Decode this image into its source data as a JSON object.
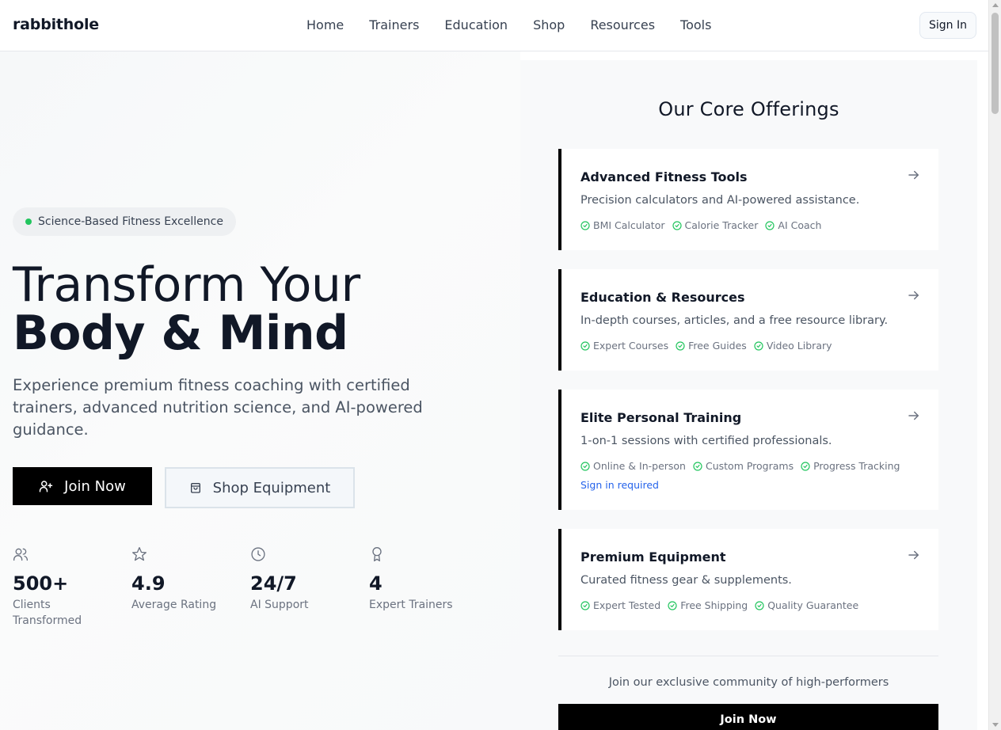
{
  "header": {
    "brand": "rabbithole",
    "nav": [
      "Home",
      "Trainers",
      "Education",
      "Shop",
      "Resources",
      "Tools"
    ],
    "sign_in": "Sign In"
  },
  "hero": {
    "badge": "Science-Based Fitness Excellence",
    "title_line1": "Transform Your",
    "title_line2": "Body & Mind",
    "lead": "Experience premium fitness coaching with certified trainers, advanced nutrition science, and AI-powered guidance.",
    "join_button": "Join Now",
    "shop_button": "Shop Equipment",
    "stats": [
      {
        "icon": "users-icon",
        "value": "500+",
        "label": "Clients Transformed"
      },
      {
        "icon": "star-icon",
        "value": "4.9",
        "label": "Average Rating"
      },
      {
        "icon": "clock-icon",
        "value": "24/7",
        "label": "AI Support"
      },
      {
        "icon": "award-icon",
        "value": "4",
        "label": "Expert Trainers"
      }
    ]
  },
  "offerings": {
    "title": "Our Core Offerings",
    "cards": [
      {
        "title": "Advanced Fitness Tools",
        "desc": "Precision calculators and AI-powered assistance.",
        "tags": [
          "BMI Calculator",
          "Calorie Tracker",
          "AI Coach"
        ],
        "link": ""
      },
      {
        "title": "Education & Resources",
        "desc": "In-depth courses, articles, and a free resource library.",
        "tags": [
          "Expert Courses",
          "Free Guides",
          "Video Library"
        ],
        "link": ""
      },
      {
        "title": "Elite Personal Training",
        "desc": "1-on-1 sessions with certified professionals.",
        "tags": [
          "Online & In-person",
          "Custom Programs",
          "Progress Tracking"
        ],
        "link": "Sign in required"
      },
      {
        "title": "Premium Equipment",
        "desc": "Curated fitness gear & supplements.",
        "tags": [
          "Expert Tested",
          "Free Shipping",
          "Quality Guarantee"
        ],
        "link": ""
      }
    ],
    "community": "Join our exclusive community of high-performers",
    "join_button": "Join Now"
  },
  "colors": {
    "accent": "#000000",
    "check": "#22c55e",
    "link": "#2563eb",
    "badge_dot": "#22c55e"
  }
}
